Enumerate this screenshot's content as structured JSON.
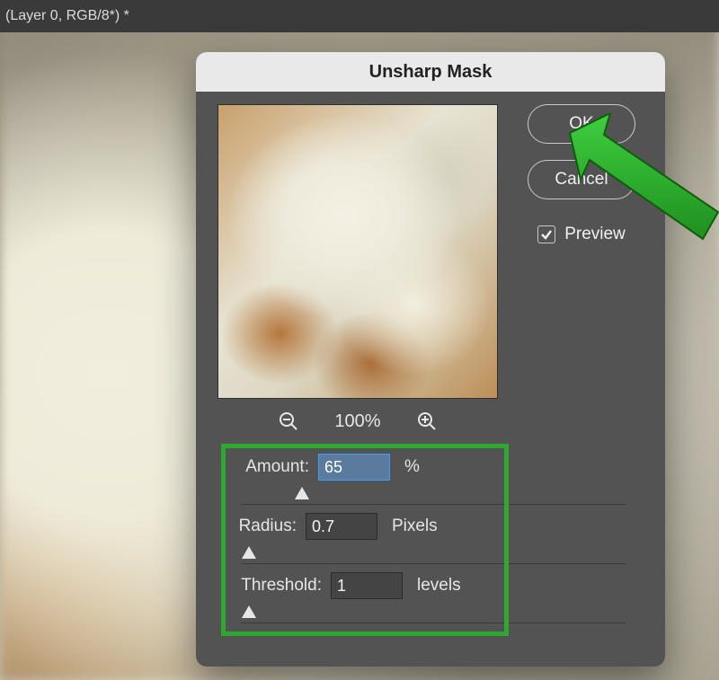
{
  "titlebar": "(Layer 0, RGB/8*) *",
  "dialog": {
    "title": "Unsharp Mask",
    "buttons": {
      "ok": "OK",
      "cancel": "Cancel"
    },
    "preview_label": "Preview",
    "preview_checked": true,
    "zoom": {
      "level": "100%"
    },
    "params": {
      "amount": {
        "label": "Amount:",
        "value": "65",
        "unit": "%",
        "slider_pct": 16
      },
      "radius": {
        "label": "Radius:",
        "value": "0.7",
        "unit": "Pixels",
        "slider_pct": 2
      },
      "threshold": {
        "label": "Threshold:",
        "value": "1",
        "unit": "levels",
        "slider_pct": 2
      }
    }
  }
}
